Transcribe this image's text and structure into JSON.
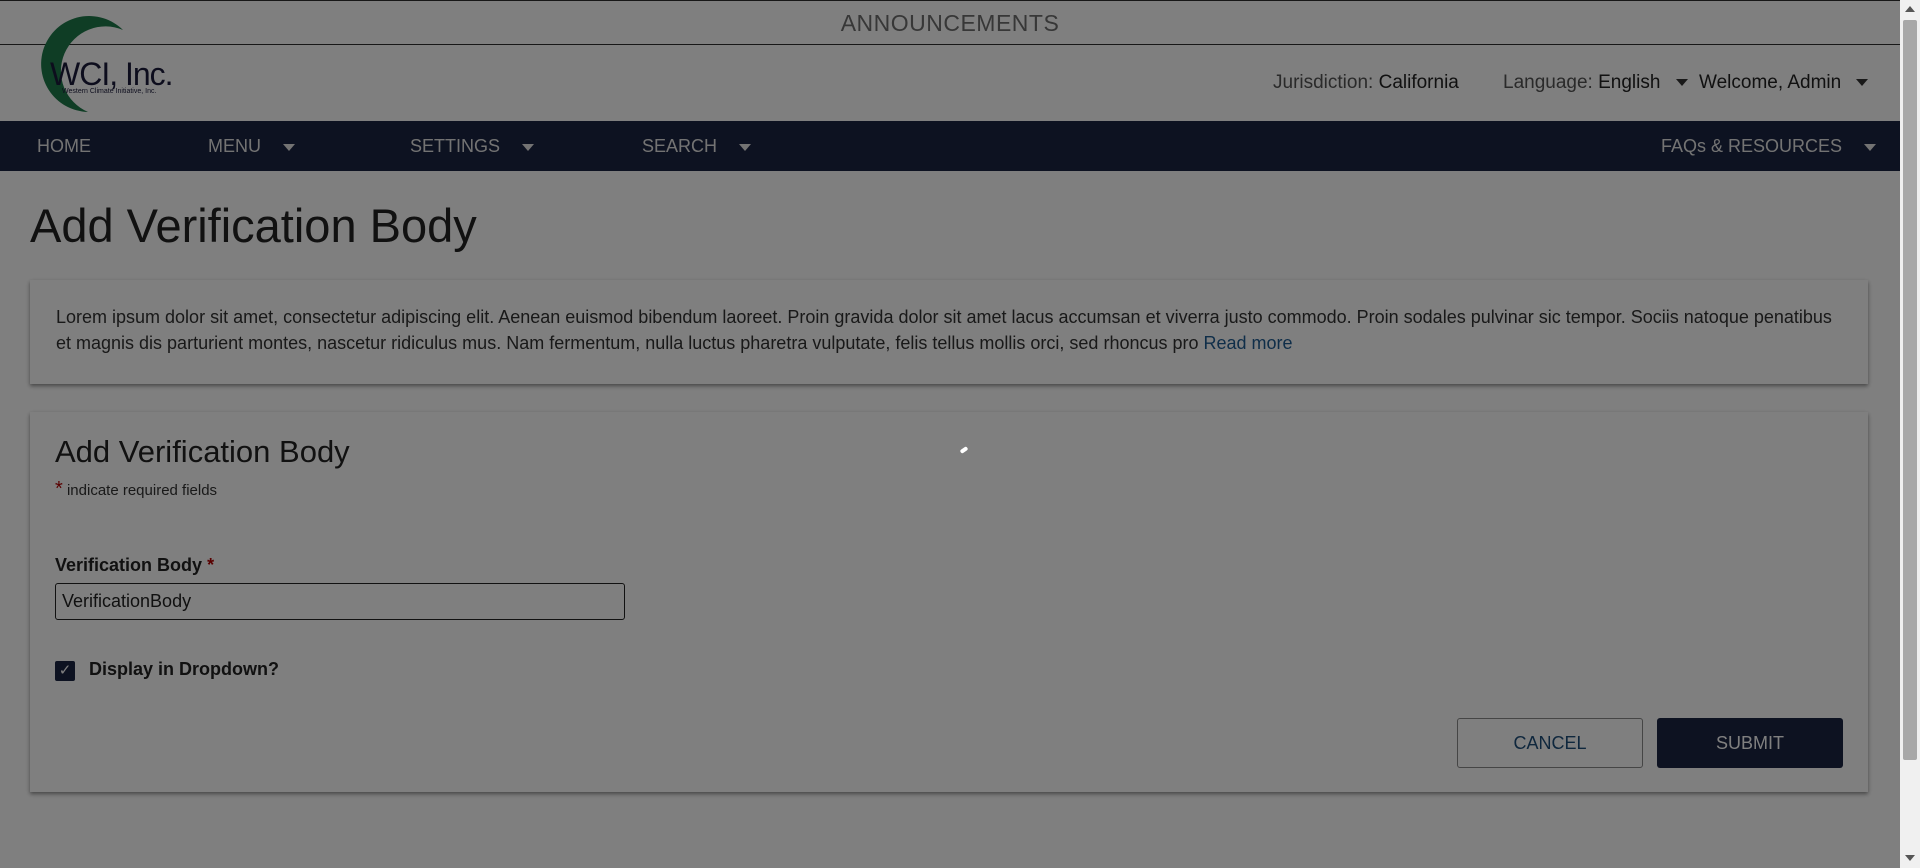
{
  "announcements": {
    "label": "ANNOUNCEMENTS"
  },
  "logo": {
    "name": "WCI, Inc.",
    "tagline": "Western Climate Initiative, Inc."
  },
  "header": {
    "jurisdiction_label": "Jurisdiction:",
    "jurisdiction_value": "California",
    "language_label": "Language:",
    "language_value": "English",
    "welcome": "Welcome, Admin"
  },
  "nav": {
    "home": "HOME",
    "menu": "MENU",
    "settings": "SETTINGS",
    "search": "SEARCH",
    "faqs": "FAQs & RESOURCES"
  },
  "page": {
    "title": "Add Verification Body",
    "intro_text": "Lorem ipsum dolor sit amet, consectetur adipiscing elit. Aenean euismod bibendum laoreet. Proin gravida dolor sit amet lacus accumsan et viverra justo commodo. Proin sodales pulvinar sic tempor. Sociis natoque penatibus et magnis dis parturient montes, nascetur ridiculus mus. Nam fermentum, nulla luctus pharetra vulputate, felis tellus mollis orci, sed rhoncus pro",
    "read_more": "Read more"
  },
  "form": {
    "title": "Add Verification Body",
    "required_star": "*",
    "required_note": "indicate required fields",
    "verification_body_label": "Verification Body",
    "verification_body_value": "VerificationBody",
    "display_dropdown_label": "Display in Dropdown?",
    "display_dropdown_checked": true,
    "cancel": "CANCEL",
    "submit": "SUBMIT"
  },
  "colors": {
    "nav_bg": "#1b2442",
    "logo_green": "#1f7a4a",
    "required_red": "#b30000",
    "link_blue": "#1e5c93"
  }
}
